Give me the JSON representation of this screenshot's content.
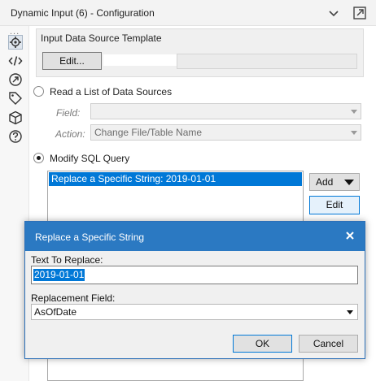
{
  "window": {
    "title": "Dynamic Input (6) - Configuration",
    "collapse_icon": "chevron-down-icon",
    "popout_icon": "popout-icon"
  },
  "rail": {
    "dots": "...",
    "icons": [
      "gear-icon",
      "code-icon",
      "link-icon",
      "tag-icon",
      "cube-icon",
      "help-icon"
    ]
  },
  "template_group": {
    "label": "Input Data Source Template",
    "edit_label": "Edit..."
  },
  "read_list": {
    "label": "Read a List of Data Sources",
    "selected": false,
    "field_label": "Field:",
    "field_value": "",
    "action_label": "Action:",
    "action_value": "Change File/Table Name"
  },
  "modify_sql": {
    "label": "Modify SQL Query",
    "selected": true,
    "items": [
      "Replace a Specific String: 2019-01-01"
    ],
    "add_label": "Add",
    "edit_label": "Edit"
  },
  "dialog": {
    "title": "Replace a Specific String",
    "text_to_replace_label": "Text To Replace:",
    "text_to_replace_value": "2019-01-01",
    "replacement_field_label": "Replacement Field:",
    "replacement_field_value": "AsOfDate",
    "ok_label": "OK",
    "cancel_label": "Cancel"
  },
  "colors": {
    "accent": "#0078d7",
    "dialog_title": "#2b79c2"
  }
}
